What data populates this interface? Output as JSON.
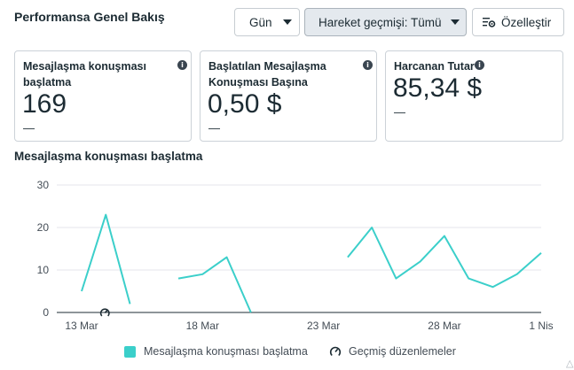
{
  "header": {
    "title": "Performansa Genel Bakış"
  },
  "controls": {
    "period_label": "Gün",
    "history_label": "Hareket geçmişi: Tümü",
    "customize_label": "Özelleştir"
  },
  "cards": [
    {
      "label": "Mesajlaşma konuşması başlatma",
      "value": "169",
      "delta": "—"
    },
    {
      "label": "Başlatılan Mesajlaşma Konuşması Başına",
      "value": "0,50 $",
      "delta": "—"
    },
    {
      "label": "Harcanan Tutar",
      "value": "85,34 $",
      "delta": "—"
    }
  ],
  "colors": {
    "series": "#3bcfca",
    "grid": "#e4e6eb",
    "axis": "#1c2b33"
  },
  "chart_data": {
    "type": "line",
    "title": "Mesajlaşma konuşması başlatma",
    "x": [
      "13 Mar",
      "14 Mar",
      "15 Mar",
      "16 Mar",
      "17 Mar",
      "18 Mar",
      "19 Mar",
      "20 Mar",
      "21 Mar",
      "22 Mar",
      "23 Mar",
      "24 Mar",
      "25 Mar",
      "26 Mar",
      "27 Mar",
      "28 Mar",
      "29 Mar",
      "30 Mar",
      "31 Mar",
      "1 Nis"
    ],
    "x_tick_labels": [
      "13 Mar",
      "18 Mar",
      "23 Mar",
      "28 Mar",
      "1 Nis"
    ],
    "x_tick_positions": [
      0,
      5,
      10,
      15,
      19
    ],
    "yticks": [
      0,
      10,
      20,
      30
    ],
    "ylim": [
      0,
      30
    ],
    "grid": true,
    "series": [
      {
        "name": "Mesajlaşma konuşması başlatma",
        "values": [
          5,
          23,
          2,
          null,
          8,
          9,
          13,
          0,
          null,
          null,
          null,
          13,
          20,
          8,
          12,
          18,
          8,
          6,
          9,
          14
        ]
      }
    ],
    "annotations": [
      {
        "x": "14 Mar",
        "icon": "history-edit-icon"
      }
    ],
    "legend": [
      {
        "label": "Mesajlaşma konuşması başlatma",
        "kind": "swatch"
      },
      {
        "label": "Geçmiş düzenlemeler",
        "kind": "history-edit-icon"
      }
    ],
    "legend_position": "bottom"
  }
}
